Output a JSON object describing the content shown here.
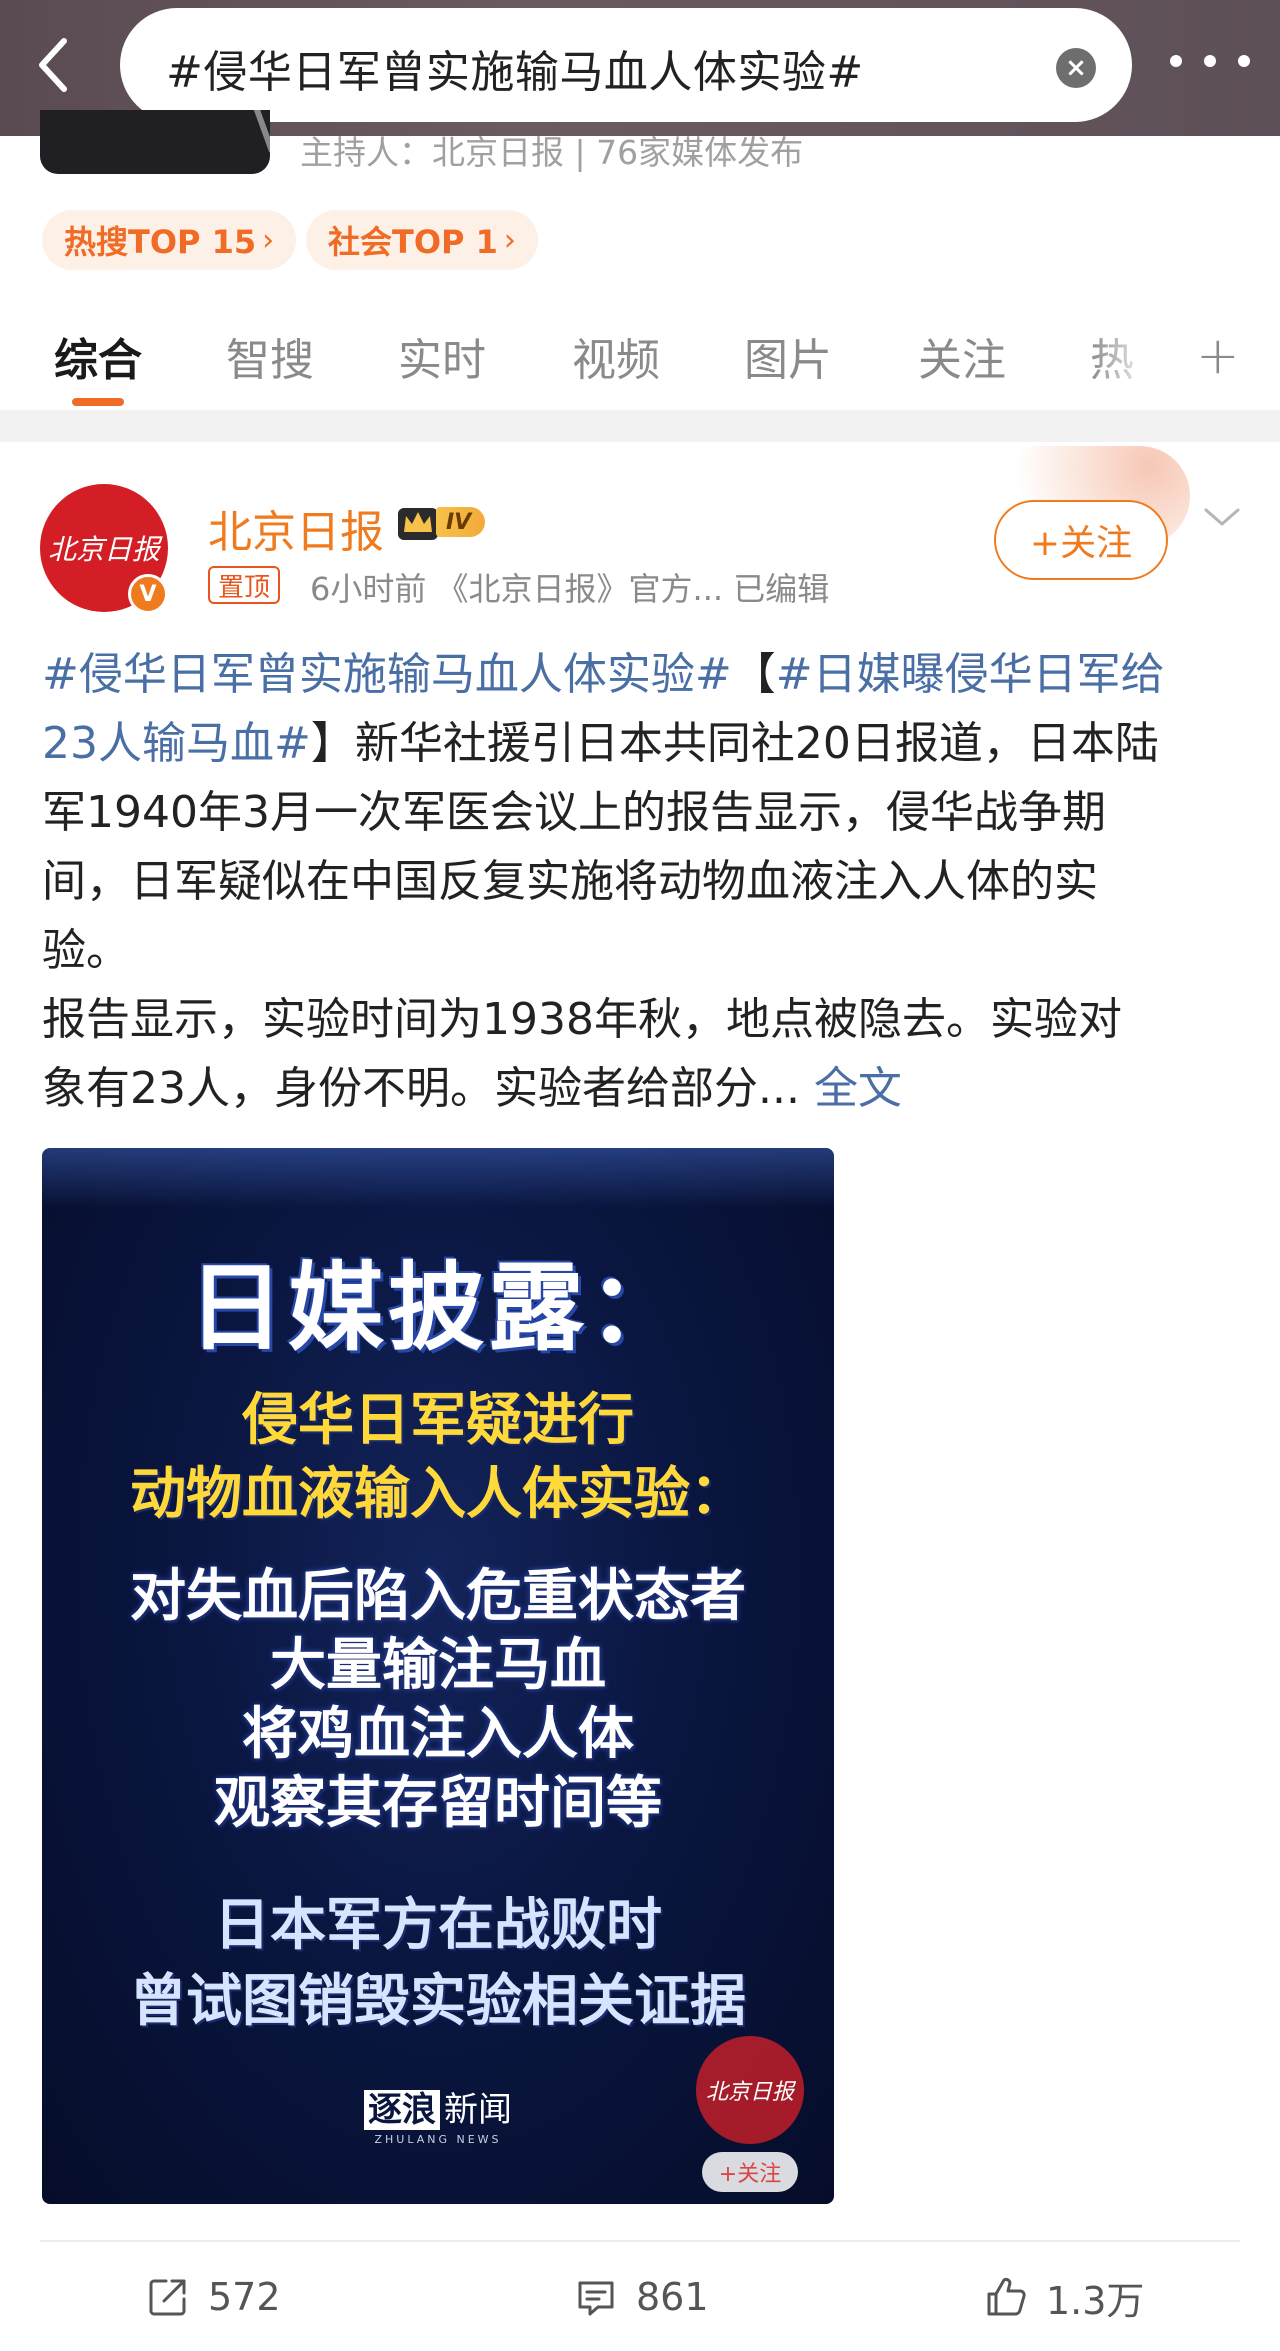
{
  "search": {
    "query": "#侵华日军曾实施输马血人体实验#"
  },
  "topic_header": {
    "host_line": "主持人：北京日报 | 76家媒体发布"
  },
  "hot_tags": [
    {
      "label": "热搜TOP 15",
      "arrow": "›"
    },
    {
      "label": "社会TOP 1",
      "arrow": "›"
    }
  ],
  "tabs": [
    {
      "label": "综合",
      "active": true
    },
    {
      "label": "智搜",
      "active": false
    },
    {
      "label": "实时",
      "active": false
    },
    {
      "label": "视频",
      "active": false
    },
    {
      "label": "图片",
      "active": false
    },
    {
      "label": "关注",
      "active": false
    },
    {
      "label": "热",
      "active": false
    }
  ],
  "tab_add": "+",
  "post": {
    "author": "北京日报",
    "avatar_text": "北京日报",
    "verified_mark": "V",
    "vip_level": "IV",
    "pinned_label": "置顶",
    "meta": "6小时前 《北京日报》官方...  已编辑",
    "follow_label": "+关注",
    "body_lines": {
      "l1_tag": "#侵华日军曾实施输马血人体实验#",
      "l1_bracket": "【",
      "l1_tag2": "#日媒曝侵华日军给",
      "l2_tag2": "23人输马血#",
      "l2_text": "】新华社援引日本共同社20日报道，日本陆",
      "l3": "军1940年3月一次军医会议上的报告显示，侵华战争期",
      "l4": "间，日军疑似在中国反复实施将动物血液注入人体的实",
      "l5": "验。",
      "l6": "报告显示，实验时间为1938年秋，地点被隐去。实验对",
      "l7_text": "象有23人，身份不明。实验者给部分... ",
      "l7_link": "全文"
    },
    "image": {
      "title": "日媒披露：",
      "yellow_lines": [
        "侵华日军疑进行",
        "动物血液输入人体实验："
      ],
      "white_lines": [
        "对失血后陷入危重状态者",
        "大量输注马血",
        "将鸡血注入人体",
        "观察其存留时间等"
      ],
      "blue_lines": [
        "日本军方在战败时",
        "曾试图销毁实验相关证据"
      ],
      "source_brand": "逐浪",
      "source_name": "新闻",
      "source_sub": "ZHULANG NEWS",
      "watermark_logo": "北京日报",
      "watermark_follow": "+关注"
    },
    "actions": {
      "repost_count": "572",
      "comment_count": "861",
      "like_count": "1.3万"
    }
  },
  "colors": {
    "accent_orange": "#f07a1e",
    "hashtag_blue": "#4a6fa5",
    "header_bg": "#5e5058"
  }
}
